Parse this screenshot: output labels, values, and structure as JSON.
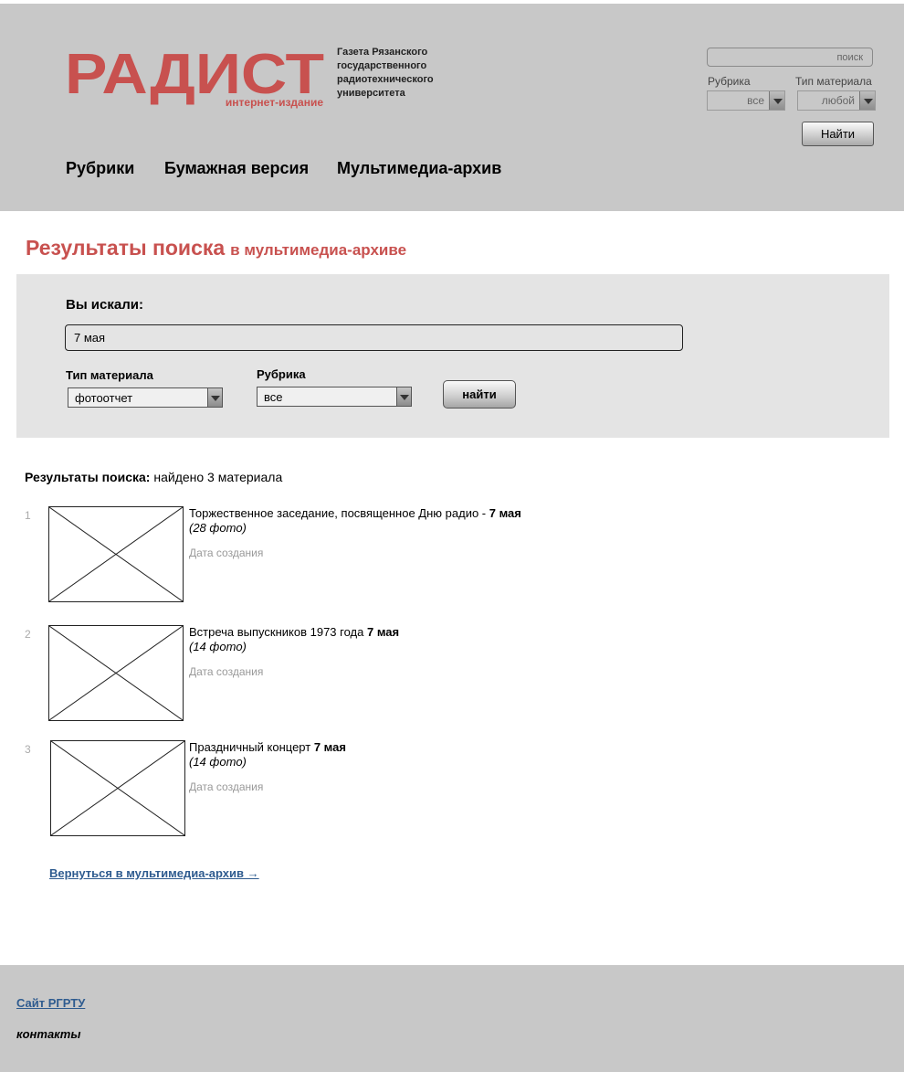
{
  "header": {
    "logo_text": "РАДИСТ",
    "logo_subtitle": "интернет-издание",
    "tagline": "Газета Рязанского государственного радиотехнического университета",
    "search_placeholder": "поиск",
    "rubric_label": "Рубрика",
    "rubric_value": "все",
    "type_label": "Тип материала",
    "type_value": "любой",
    "find_button": "Найти",
    "nav": [
      "Рубрики",
      "Бумажная версия",
      "Мультимедиа-архив"
    ]
  },
  "page_title": {
    "main": "Результаты поиска",
    "sub": "в мультимедиа-архиве"
  },
  "search_panel": {
    "heading": "Вы искали:",
    "query": "7 мая",
    "type_label": "Тип материала",
    "type_value": "фотоотчет",
    "rubric_label": "Рубрика",
    "rubric_value": "все",
    "button": "найти"
  },
  "results": {
    "summary_label": "Результаты поиска:",
    "summary_text": "найдено 3 материала",
    "items": [
      {
        "num": "1",
        "title": "Торжественное заседание, посвященное Дню радио - ",
        "title_bold": "7 мая",
        "count": "(28 фото)",
        "date": "Дата создания"
      },
      {
        "num": "2",
        "title": "Встреча выпускников 1973 года ",
        "title_bold": "7 мая",
        "count": "(14 фото)",
        "date": "Дата создания"
      },
      {
        "num": "3",
        "title": "Праздничный концерт ",
        "title_bold": "7 мая",
        "count": "(14 фото)",
        "date": "Дата создания"
      }
    ],
    "back_link": "Вернуться в мультимедиа-архив →"
  },
  "footer": {
    "site_link": "Сайт РГРТУ",
    "contacts": "контакты"
  },
  "colors": {
    "brand_red": "#c8514f",
    "header_bg": "#c8c8c8",
    "panel_bg": "#e4e4e4",
    "link_blue": "#2e5b8f"
  }
}
